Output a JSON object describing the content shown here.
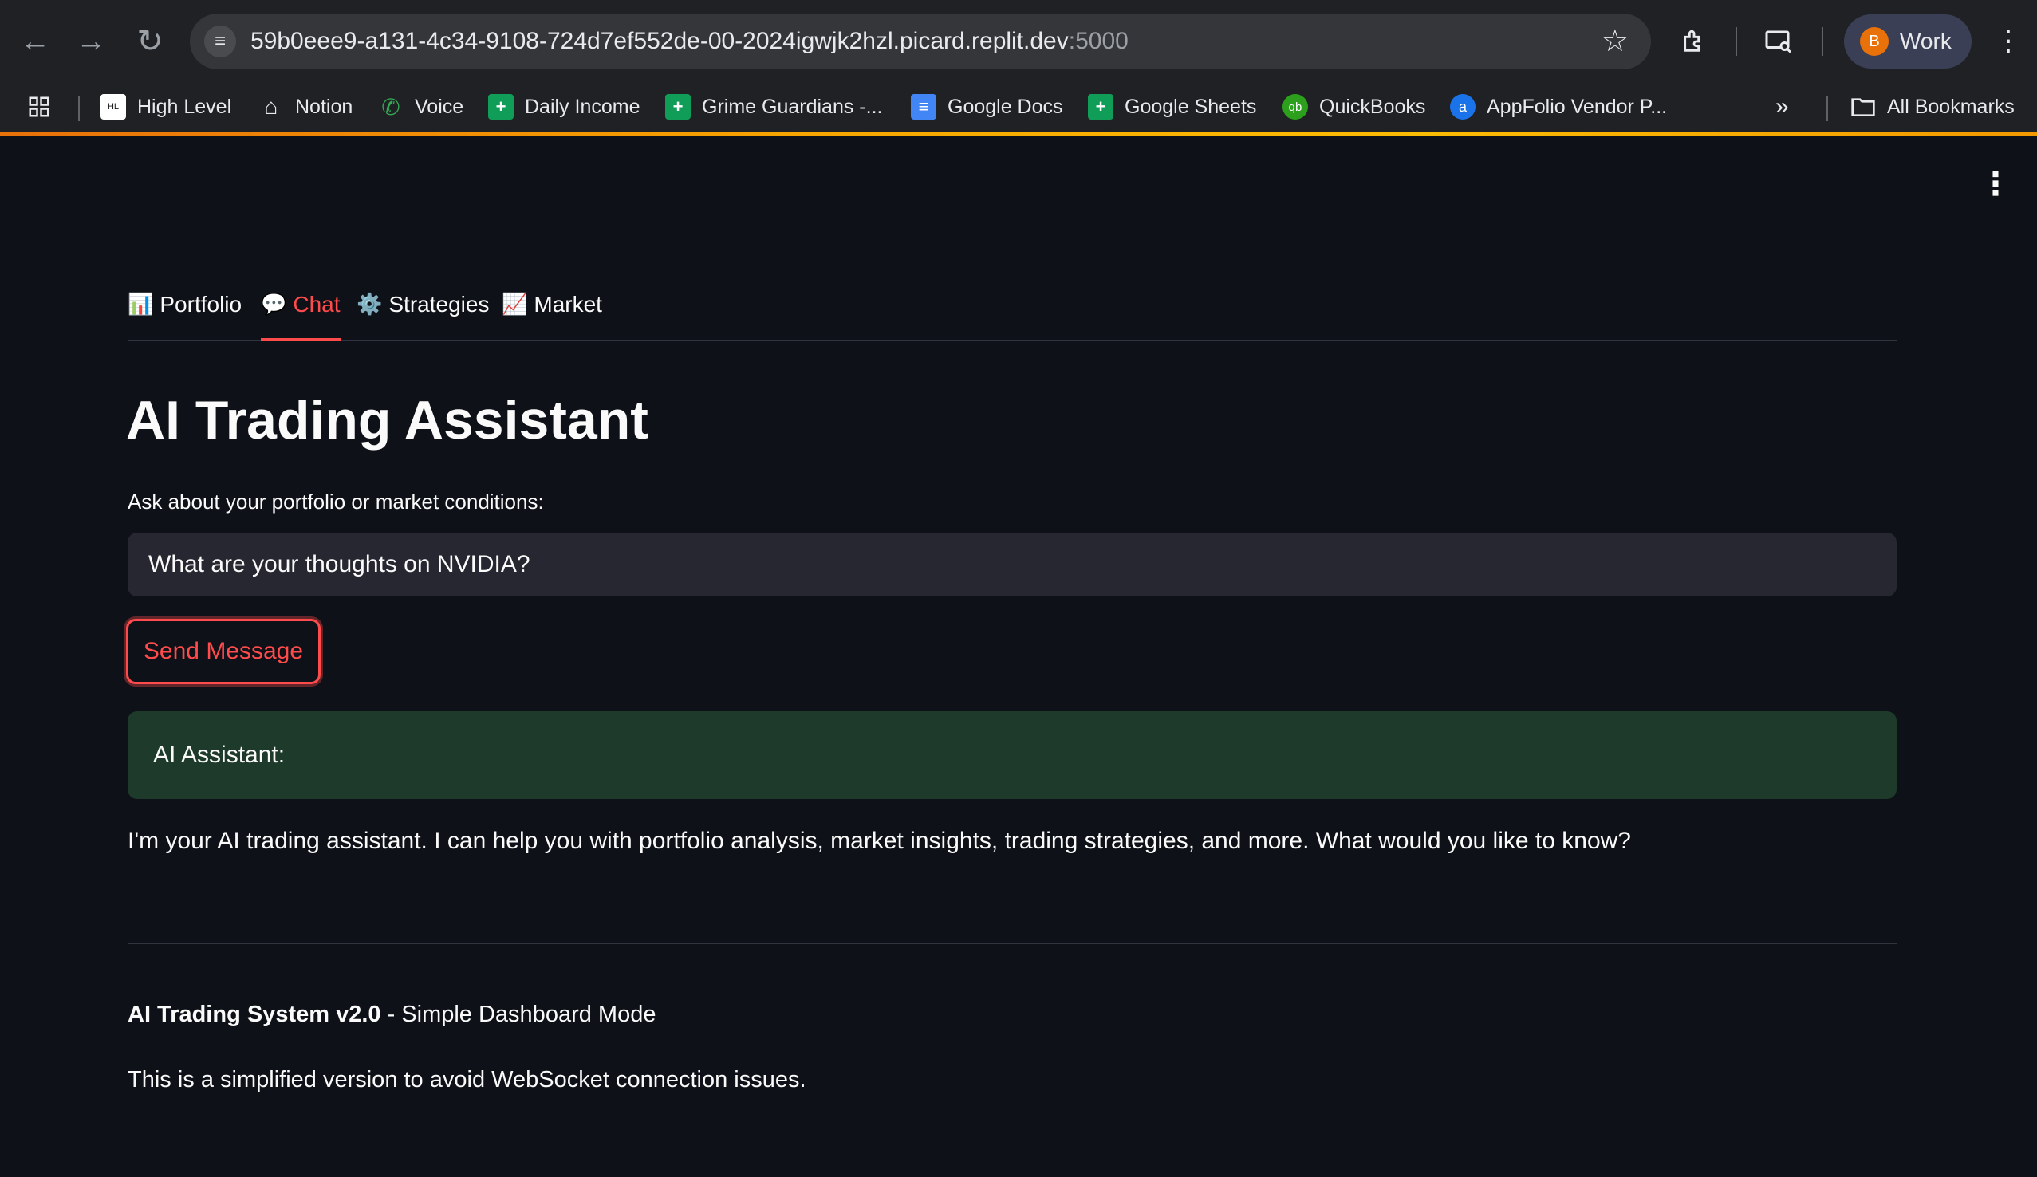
{
  "browser": {
    "url_main": "59b0eee9-a131-4c34-9108-724d7ef552de-00-2024igwjk2hzl.picard.replit.dev",
    "url_port": ":5000",
    "profile_initial": "B",
    "profile_name": "Work",
    "icons": {
      "back": "arrow-left-icon",
      "forward": "arrow-right-icon",
      "reload": "reload-icon",
      "site_info": "tune-icon",
      "bookmark_star": "star-icon",
      "extensions": "puzzle-icon",
      "cast": "screen-search-icon",
      "menu": "kebab-icon"
    },
    "bookmarks": [
      {
        "label": "High Level",
        "icon": "highlevel-icon"
      },
      {
        "label": "Notion",
        "icon": "home-icon"
      },
      {
        "label": "Voice",
        "icon": "phone-icon"
      },
      {
        "label": "Daily Income",
        "icon": "sheets-icon"
      },
      {
        "label": "Grime Guardians -...",
        "icon": "sheets-icon"
      },
      {
        "label": "Google Docs",
        "icon": "docs-icon"
      },
      {
        "label": "Google Sheets",
        "icon": "sheets-icon"
      },
      {
        "label": "QuickBooks",
        "icon": "quickbooks-icon"
      },
      {
        "label": "AppFolio Vendor P...",
        "icon": "appfolio-icon"
      }
    ],
    "all_bookmarks": "All Bookmarks"
  },
  "app": {
    "tabs": [
      {
        "label": "Portfolio",
        "emoji": "📊"
      },
      {
        "label": "Chat",
        "emoji": "💬"
      },
      {
        "label": "Strategies",
        "emoji": "⚙️"
      },
      {
        "label": "Market",
        "emoji": "📈"
      }
    ],
    "active_tab": "Chat",
    "title": "AI Trading Assistant",
    "input_label": "Ask about your portfolio or market conditions:",
    "input_value": "What are your thoughts on NVIDIA?",
    "send_label": "Send Message",
    "assistant_label": "AI Assistant:",
    "assistant_response": "I'm your AI trading assistant. I can help you with portfolio analysis, market insights, trading strategies, and more. What would you like to know?",
    "footer_bold": "AI Trading System v2.0",
    "footer_rest": " - Simple Dashboard Mode",
    "footer_note": "This is a simplified version to avoid WebSocket connection issues."
  },
  "colors": {
    "background": "#0e1117",
    "accent": "#ff4b4b",
    "input_bg": "#262730",
    "success_bg": "#1d3a2a"
  }
}
